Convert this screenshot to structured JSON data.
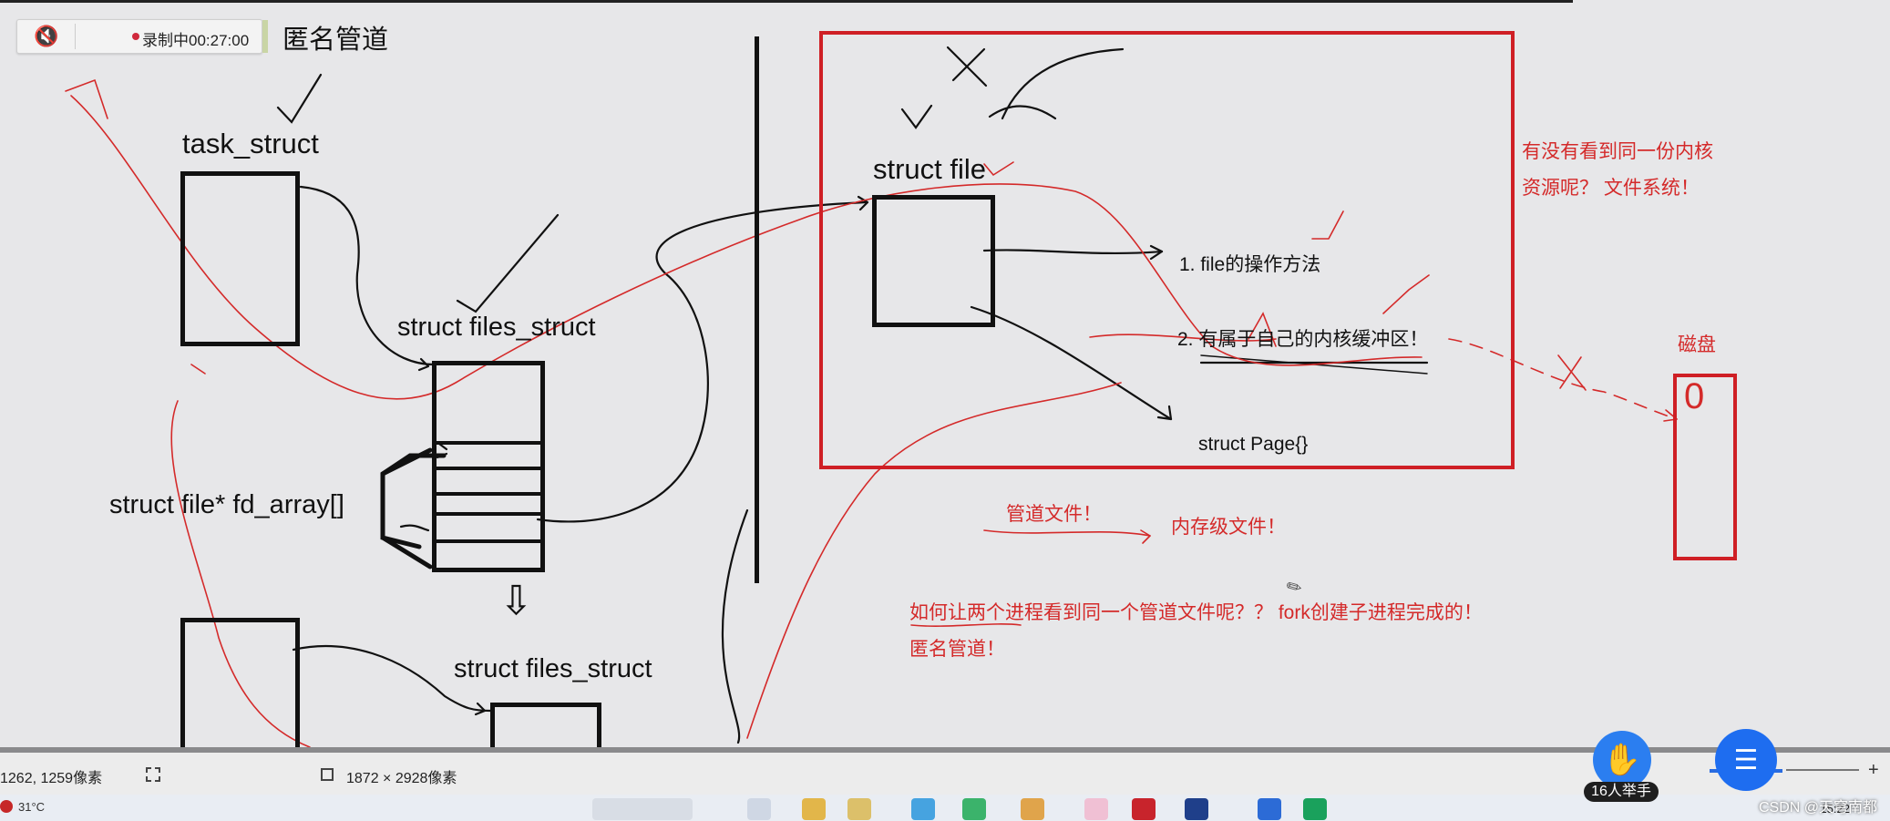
{
  "recorder": {
    "status": "录制中00:27:00",
    "mute_icon": "speaker-muted-icon"
  },
  "board": {
    "title": "匿名管道",
    "task_struct": "task_struct",
    "files_struct_1": "struct files_struct",
    "files_struct_2": "struct files_struct",
    "fd_array": "struct file* fd_array[]",
    "struct_file": "struct file",
    "item1": "1. file的操作方法",
    "item2": "2. 有属于自己的内核缓冲区！",
    "struct_page": "struct Page{}",
    "red_note_1": "有没有看到同一份内核",
    "red_note_2": "资源呢？  文件系统！",
    "disk_label": "磁盘",
    "disk_mark": "0",
    "pipe_file": "管道文件！",
    "mem_file": "内存级文件！",
    "question": "如何让两个进程看到同一个管道文件呢？？ fork创建子进程完成的！",
    "anon_pipe": "匿名管道！",
    "ink_color": "#111111",
    "red_color": "#d42a2a"
  },
  "statusbar": {
    "coords": "1262, 1259像素",
    "size": "1872 × 2928像素",
    "selection_icon": "selection-icon",
    "crop_icon": "crop-icon"
  },
  "taskbar": {
    "weather": "31°C",
    "clock": "15:22"
  },
  "overlay": {
    "raise_hand_count": "16人举手",
    "chat_icon": "chat-bubble-icon",
    "watermark": "CSDN @天穹南都"
  }
}
